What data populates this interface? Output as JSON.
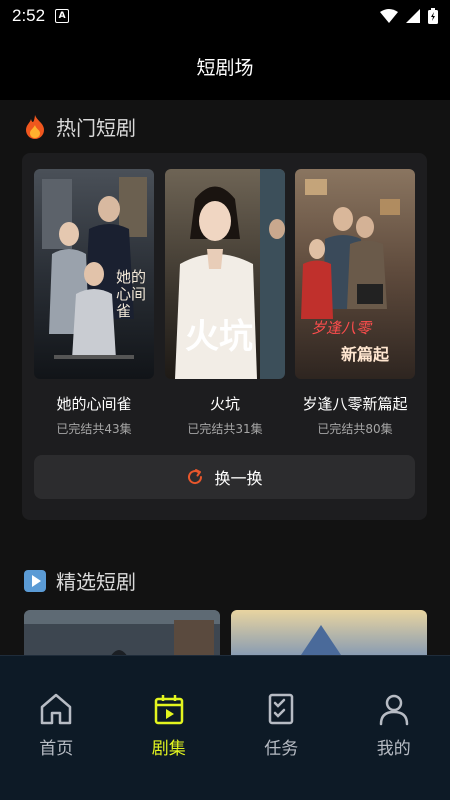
{
  "status": {
    "time": "2:52",
    "badge": "A"
  },
  "header": {
    "title": "短剧场"
  },
  "hot": {
    "title": "热门短剧",
    "icon": "fire-icon",
    "dramas": [
      {
        "title": "她的心间雀",
        "sub": "已完结共43集",
        "poster_text": "她的心间雀"
      },
      {
        "title": "火坑",
        "sub": "已完结共31集",
        "poster_text": "火坑"
      },
      {
        "title": "岁逢八零新篇起",
        "sub": "已完结共80集",
        "poster_text_1": "岁逢八零",
        "poster_text_2": "新篇起"
      }
    ],
    "swap_label": "换一换"
  },
  "featured": {
    "title": "精选短剧",
    "icon": "play-icon"
  },
  "nav": {
    "items": [
      {
        "label": "首页",
        "icon": "home-icon"
      },
      {
        "label": "剧集",
        "icon": "episodes-icon",
        "active": true
      },
      {
        "label": "任务",
        "icon": "task-icon"
      },
      {
        "label": "我的",
        "icon": "profile-icon"
      }
    ]
  },
  "colors": {
    "accent": "#e3f51f",
    "nav_bg": "#0d1a26",
    "panel": "#1d1d1f",
    "swap_icon": "#e8572c"
  }
}
